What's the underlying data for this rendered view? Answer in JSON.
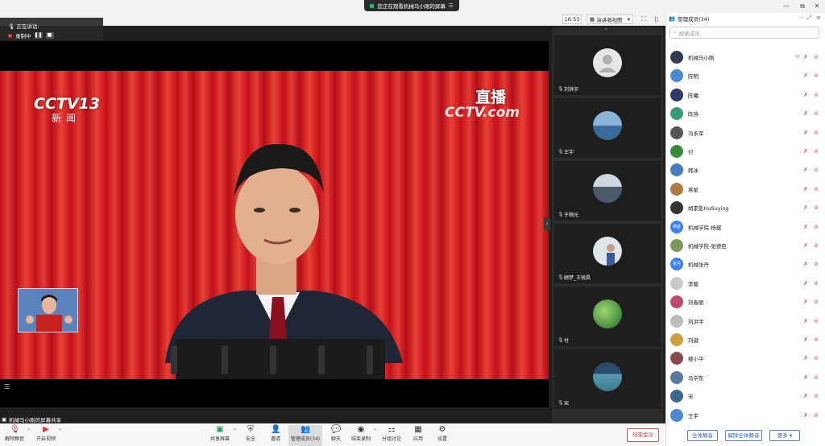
{
  "window": {
    "share_banner": "您正在观看机械马小刚的屏幕",
    "controls": [
      "—",
      "⧉",
      "✕"
    ]
  },
  "subbar": {
    "time": "16:53",
    "view_mode": "演讲者视图"
  },
  "speaking": {
    "label": "正在讲话:",
    "recording": "录制中"
  },
  "video": {
    "channel_logo": "CCTV13",
    "channel_sub": "新闻",
    "live": "直播",
    "watermark": "CCTV.com"
  },
  "thumbnails": [
    {
      "name": "刘洪宇",
      "avatar": "default"
    },
    {
      "name": "王宇",
      "avatar": "lake"
    },
    {
      "name": "于顺光",
      "avatar": "pavilion"
    },
    {
      "name": "顾梦_王锐昌",
      "avatar": "person"
    },
    {
      "name": "付",
      "avatar": "leaf"
    },
    {
      "name": "宋",
      "avatar": "mountain"
    }
  ],
  "share_info": "机械马小刚的屏幕共享",
  "toolbar": {
    "unmute": "解除静音",
    "video": "开启视频",
    "share": "共享屏幕",
    "security": "安全",
    "invite": "邀请",
    "members": "管理成员(34)",
    "chat": "聊天",
    "record": "结束录制",
    "breakout": "分组讨论",
    "apps": "应用",
    "settings": "设置",
    "end": "结束会议"
  },
  "panel": {
    "title": "管理成员(34)",
    "search_placeholder": "搜索成员",
    "members": [
      {
        "name": "机械马小刚",
        "color": "#333c55",
        "host": true
      },
      {
        "name": "陈明",
        "color": "#4a8ad0"
      },
      {
        "name": "陈曦",
        "color": "#2d3a6a"
      },
      {
        "name": "陈燕",
        "color": "#3a9a7a"
      },
      {
        "name": "冯永军",
        "color": "#555"
      },
      {
        "name": "付",
        "color": "#3a8a3a"
      },
      {
        "name": "韩冰",
        "color": "#4a7ac0"
      },
      {
        "name": "寒星",
        "color": "#b07a40"
      },
      {
        "name": "胡素影HuSuying",
        "color": "#333"
      },
      {
        "name": "机械学院-杨建",
        "color": "#3b7ff0",
        "initials": "杨建"
      },
      {
        "name": "机械学院-张德臣",
        "color": "#7a9a5a"
      },
      {
        "name": "机械张丹",
        "color": "#3b7ff0",
        "initials": "张丹"
      },
      {
        "name": "李媛",
        "color": "#c8c8c8"
      },
      {
        "name": "刘春丽",
        "color": "#c04a6a"
      },
      {
        "name": "刘洪宇",
        "color": "#bdbdbd"
      },
      {
        "name": "刘键",
        "color": "#d0a040"
      },
      {
        "name": "楼小平",
        "color": "#8a4a4a"
      },
      {
        "name": "马学东",
        "color": "#5a7aa0"
      },
      {
        "name": "宋",
        "color": "#3a6a8a"
      },
      {
        "name": "王宇",
        "color": "#4a8ad0"
      }
    ],
    "mute_all": "全体静音",
    "unmute_all": "解除全体静音",
    "more": "更多"
  }
}
